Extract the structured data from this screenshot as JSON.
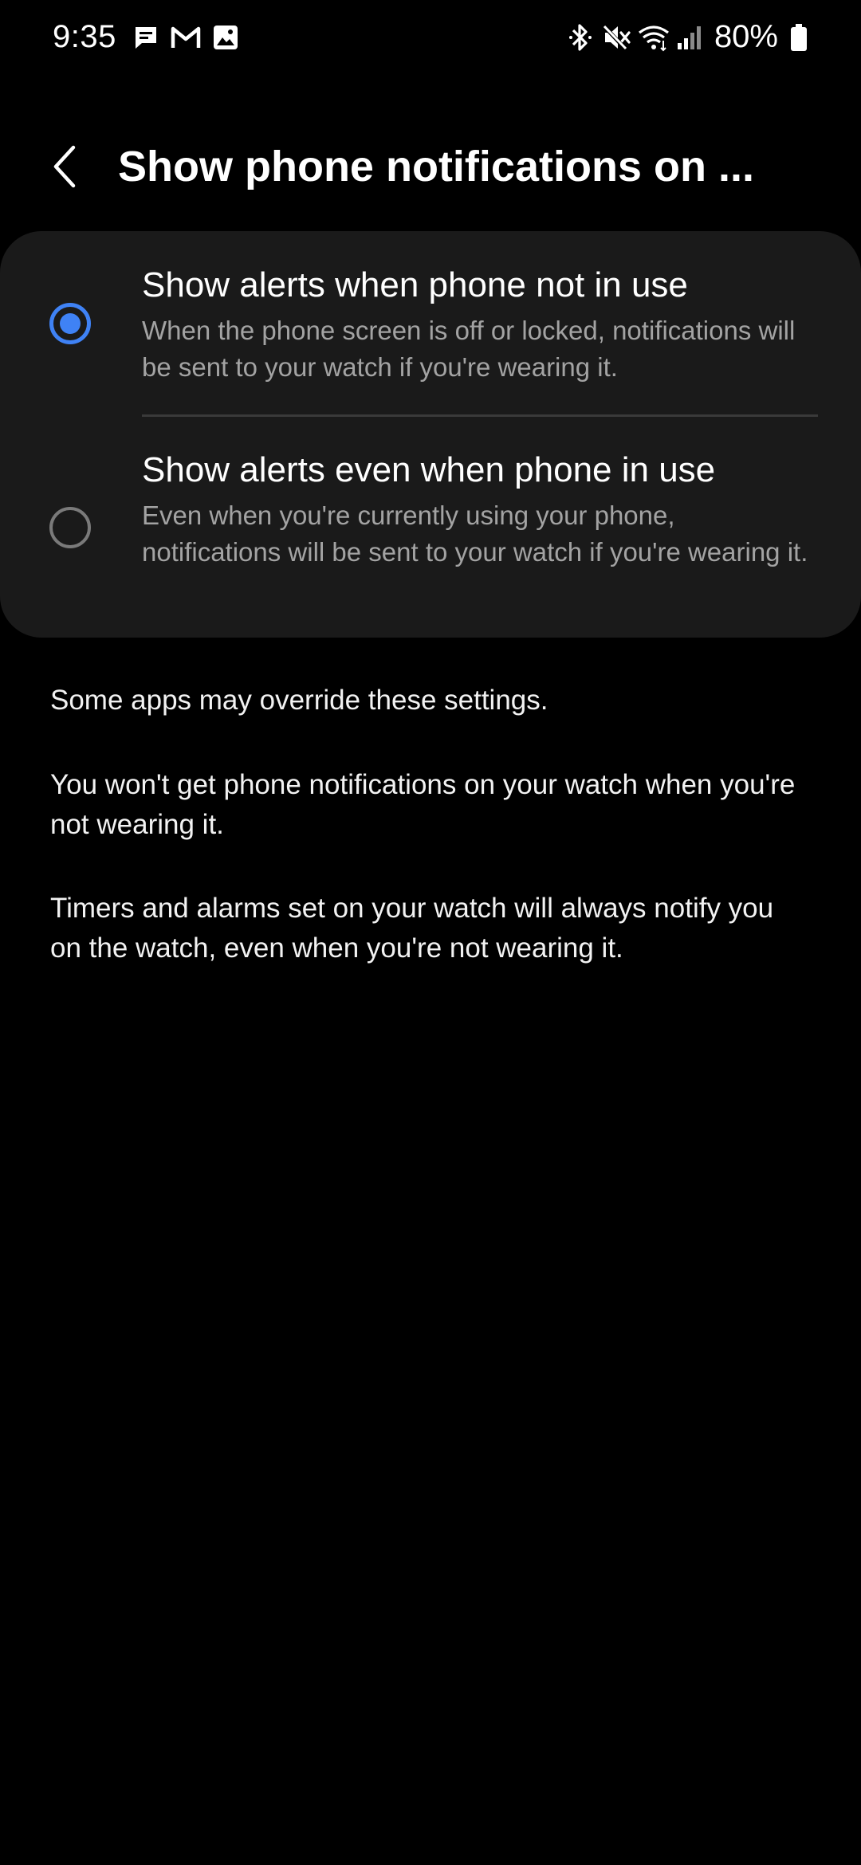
{
  "status_bar": {
    "time": "9:35",
    "battery": "80%",
    "left_icons": [
      "message-icon",
      "gmail-icon",
      "gallery-icon"
    ],
    "right_icons": [
      "bluetooth-icon",
      "mute-icon",
      "wifi-icon",
      "signal-icon",
      "battery-icon"
    ]
  },
  "header": {
    "title": "Show phone notifications on ..."
  },
  "options": [
    {
      "title": "Show alerts when phone not in use",
      "description": "When the phone screen is off or locked, notifications will be sent to your watch if you're wearing it.",
      "selected": true
    },
    {
      "title": "Show alerts even when phone in use",
      "description": "Even when you're currently using your phone, notifications will be sent to your watch if you're wearing it.",
      "selected": false
    }
  ],
  "info": [
    "Some apps may override these settings.",
    "You won't get phone notifications on your watch when you're not wearing it.",
    "Timers and alarms set on your watch will always notify you on the watch, even when you're not wearing it."
  ],
  "colors": {
    "background": "#000000",
    "card": "#1a1a1a",
    "accent": "#3f82f5",
    "secondary_text": "#a3a3a3"
  }
}
